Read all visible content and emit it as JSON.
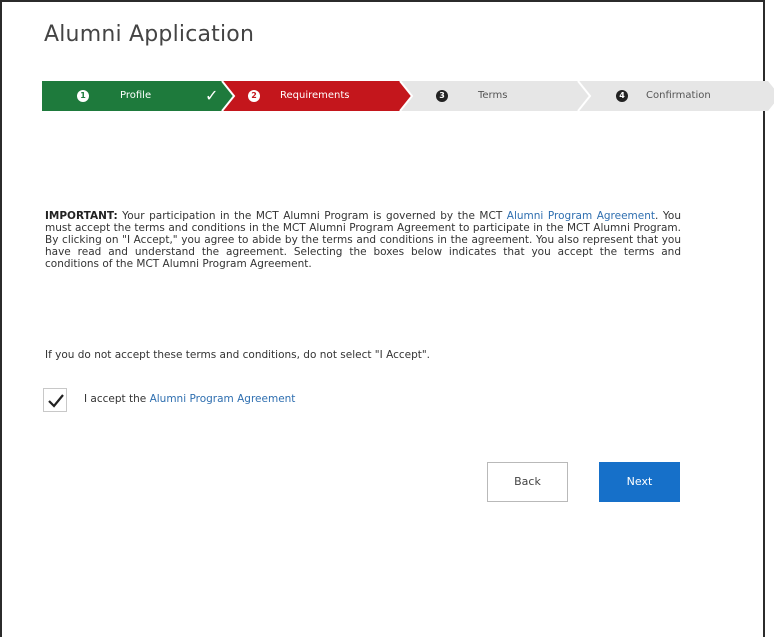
{
  "page": {
    "title": "Alumni Application"
  },
  "steps": [
    {
      "number": "1",
      "label": "Profile",
      "state": "complete",
      "color": "#1e7a3c"
    },
    {
      "number": "2",
      "label": "Requirements",
      "state": "active",
      "color": "#c4161c"
    },
    {
      "number": "3",
      "label": "Terms",
      "state": "upcoming",
      "color": "#e6e6e6"
    },
    {
      "number": "4",
      "label": "Confirmation",
      "state": "upcoming",
      "color": "#e6e6e6"
    }
  ],
  "agreement": {
    "important_label": "IMPORTANT:",
    "text_1": " Your participation in the MCT Alumni Program is governed by the MCT ",
    "link_1": "Alumni Program Agreement",
    "text_2": ". You must accept the terms and conditions in the MCT Alumni Program Agreement to participate in the MCT Alumni Program. By clicking on \"I Accept,\" you agree to abide by the terms and conditions in the agreement. You also represent that you have read and understand the agreement. Selecting the boxes below indicates that you accept the terms and conditions of the MCT Alumni Program Agreement."
  },
  "note": "If you do not accept these terms and conditions, do not select \"I Accept\".",
  "accept": {
    "checked": true,
    "label_prefix": "I accept the ",
    "link": "Alumni Program Agreement"
  },
  "buttons": {
    "back": "Back",
    "next": "Next"
  },
  "colors": {
    "complete": "#1e7a3c",
    "active": "#c4161c",
    "upcoming": "#e6e6e6",
    "link": "#2f6fb0",
    "primary_button": "#1670c9"
  }
}
